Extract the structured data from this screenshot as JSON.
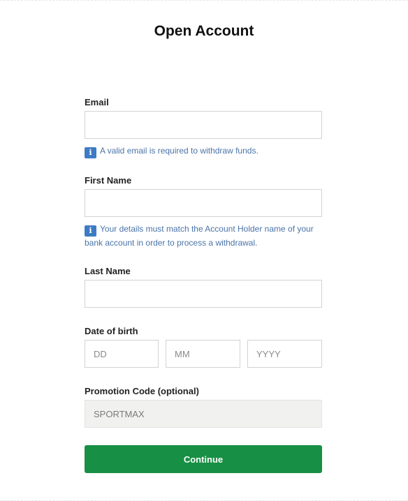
{
  "page": {
    "title": "Open Account"
  },
  "email": {
    "label": "Email",
    "value": "",
    "placeholder": "",
    "info": "A valid email is required to withdraw funds."
  },
  "first_name": {
    "label": "First Name",
    "value": "",
    "placeholder": "",
    "info": "Your details must match the Account Holder name of your bank account in order to process a withdrawal."
  },
  "last_name": {
    "label": "Last Name",
    "value": "",
    "placeholder": ""
  },
  "dob": {
    "label": "Date of birth",
    "day_placeholder": "DD",
    "month_placeholder": "MM",
    "year_placeholder": "YYYY"
  },
  "promo": {
    "label": "Promotion Code (optional)",
    "value": "SPORTMAX"
  },
  "continue_label": "Continue",
  "icons": {
    "info": "info-icon",
    "info_glyph": "i"
  },
  "colors": {
    "accent": "#178f44",
    "info_text": "#4a73a8",
    "info_icon_bg": "#3d7cc4"
  }
}
